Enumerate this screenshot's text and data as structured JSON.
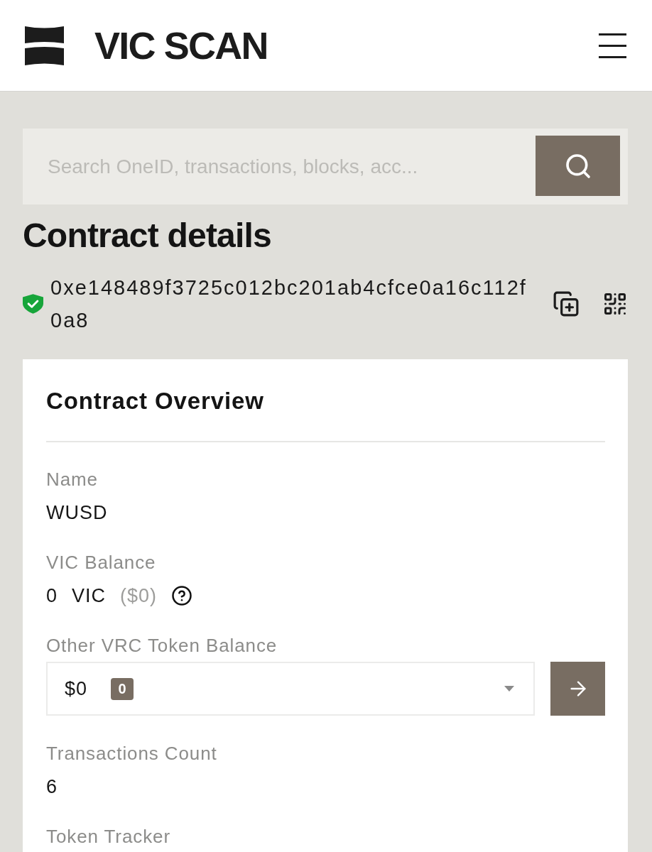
{
  "header": {
    "brand": "VIC SCAN"
  },
  "search": {
    "placeholder": "Search OneID, transactions, blocks, acc..."
  },
  "contract": {
    "title": "Contract details",
    "address": "0xe148489f3725c012bc201ab4cfce0a16c112f0a8",
    "verified": true
  },
  "overview": {
    "title": "Contract Overview",
    "fields": [
      {
        "kind": "text",
        "label": "Name",
        "value": "WUSD"
      },
      {
        "kind": "balance",
        "label": "VIC Balance",
        "amount": "0",
        "unit": "VIC",
        "usd": "($0)"
      },
      {
        "kind": "token_select",
        "label": "Other VRC Token Balance",
        "value": "$0",
        "count": "0"
      },
      {
        "kind": "text",
        "label": "Transactions Count",
        "value": "6"
      },
      {
        "kind": "text",
        "label": "Token Tracker"
      }
    ]
  }
}
